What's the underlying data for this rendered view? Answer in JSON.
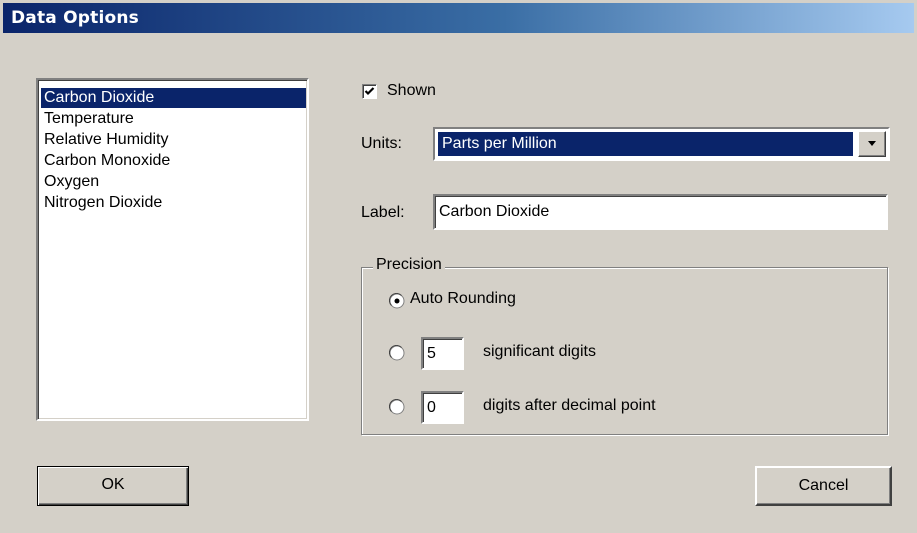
{
  "window": {
    "title": "Data Options"
  },
  "data_list": {
    "selected_index": 0,
    "items": [
      "Carbon Dioxide",
      "Temperature",
      "Relative Humidity",
      "Carbon Monoxide",
      "Oxygen",
      "Nitrogen Dioxide"
    ]
  },
  "shown": {
    "label": "Shown",
    "checked": true
  },
  "units": {
    "label": "Units:",
    "selected": "Parts per Million"
  },
  "label_field": {
    "label": "Label:",
    "value": "Carbon Dioxide"
  },
  "precision": {
    "title": "Precision",
    "auto_label": "Auto Rounding",
    "sig_value": "5",
    "sig_label": "significant digits",
    "dec_value": "0",
    "dec_label": "digits after decimal point",
    "selected": "auto"
  },
  "buttons": {
    "ok": "OK",
    "cancel": "Cancel"
  },
  "colors": {
    "face": "#d4d0c8",
    "selection": "#0a246a",
    "title_start": "#0a246a",
    "title_end": "#a6caf0"
  },
  "icons": {
    "checkbox_mark": "check-mark-icon",
    "dropdown": "chevron-down-icon"
  }
}
